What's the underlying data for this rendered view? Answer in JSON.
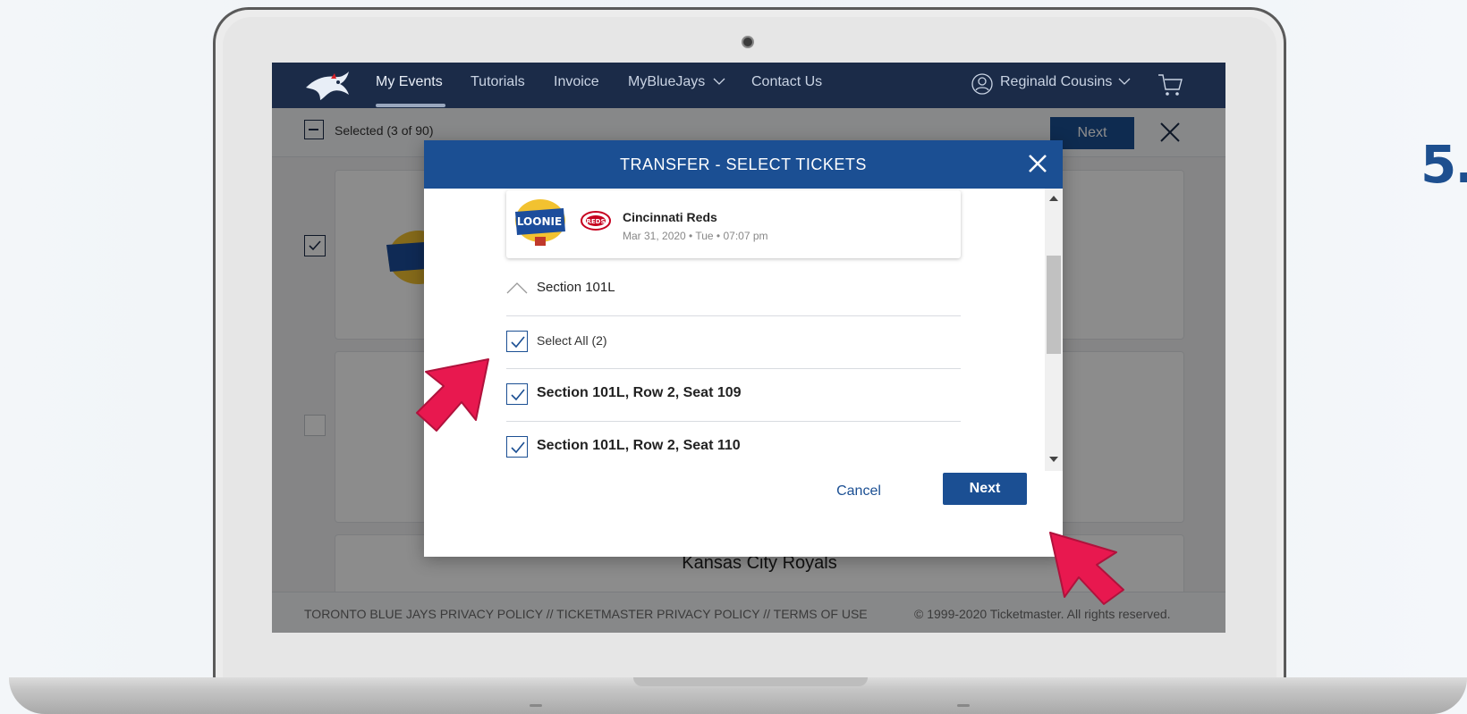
{
  "step_number": "5.",
  "app": {
    "nav": {
      "items": [
        "My Events",
        "Tutorials",
        "Invoice",
        "MyBlueJays",
        "Contact Us"
      ],
      "active_index": 0,
      "user_name": "Reginald Cousins"
    },
    "subbar": {
      "selected_text": "Selected (3 of 90)",
      "next_label": "Next"
    },
    "background_cards": {
      "card3_title": "Kansas City Royals"
    },
    "footer": {
      "links": "TORONTO BLUE JAYS PRIVACY POLICY  //  TICKETMASTER PRIVACY POLICY  //  TERMS OF USE",
      "copyright": "© 1999-2020 Ticketmaster. All rights reserved."
    }
  },
  "modal": {
    "title": "TRANSFER - SELECT TICKETS",
    "event": {
      "name": "Cincinnati Reds",
      "date": "Mar 31, 2020 • Tue • 07:07 pm"
    },
    "section_label": "Section 101L",
    "select_all_label": "Select All (2)",
    "seats": [
      "Section 101L, Row 2, Seat 109",
      "Section 101L, Row 2, Seat 110"
    ],
    "cancel_label": "Cancel",
    "next_label": "Next"
  },
  "colors": {
    "nav_bg": "#1b2b48",
    "brand_blue": "#1b4f93",
    "pointer_red": "#e8184f"
  }
}
